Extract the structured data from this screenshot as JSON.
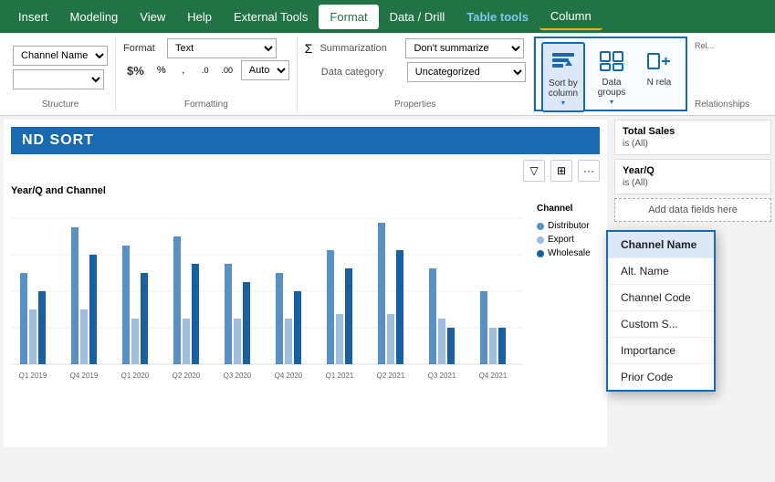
{
  "menu": {
    "items": [
      "Insert",
      "Modeling",
      "View",
      "Help",
      "External Tools",
      "Format",
      "Data / Drill",
      "Table tools",
      "Column"
    ]
  },
  "ribbon": {
    "format_group": {
      "label": "Formatting",
      "format_label": "Format",
      "format_value": "Text",
      "dollar_sign": "$%",
      "data_category_label": "Data category",
      "data_category_value": "Uncategorized",
      "auto_label": "Auto",
      "icons": [
        "%",
        ",",
        ".0",
        ".00"
      ]
    },
    "properties_group": {
      "label": "Properties",
      "summarization_label": "Summarization",
      "summarization_value": "Don't summarize",
      "data_category_label": "Data category",
      "data_category_value": "Uncategorized"
    },
    "table_tools": {
      "sort_by_column_label": "Sort by\ncolumn",
      "data_groups_label": "Data\ngroups",
      "new_related_label": "N\nrela"
    }
  },
  "section_title": "ND SORT",
  "chart": {
    "title": "Year/Q and Channel",
    "legend_title": "Channel",
    "legend_items": [
      {
        "label": "Distributor",
        "color": "#4472c4"
      },
      {
        "label": "Export",
        "color": "#a9c0e8"
      },
      {
        "label": "Wholesale",
        "color": "#1a6ab1"
      }
    ],
    "x_labels": [
      "Q1 2019",
      "Q4 2019",
      "Q1 2020",
      "Q2 2020",
      "Q3 2020",
      "Q4 2020",
      "Q1 2021",
      "Q2 2021",
      "Q3 2021",
      "Q4 2021"
    ]
  },
  "right_panel": {
    "filter1_title": "Total Sales",
    "filter1_sub": "is (All)",
    "filter2_title": "Year/Q",
    "filter2_sub": "is (All)",
    "add_field_text": "Add data fields here"
  },
  "dropdown": {
    "items": [
      {
        "label": "Channel Name",
        "highlighted": true
      },
      {
        "label": "Alt. Name",
        "highlighted": false
      },
      {
        "label": "Channel Code",
        "highlighted": false
      },
      {
        "label": "Custom S...",
        "highlighted": false
      },
      {
        "label": "Importance",
        "highlighted": false
      },
      {
        "label": "Prior Code",
        "highlighted": false
      }
    ]
  }
}
